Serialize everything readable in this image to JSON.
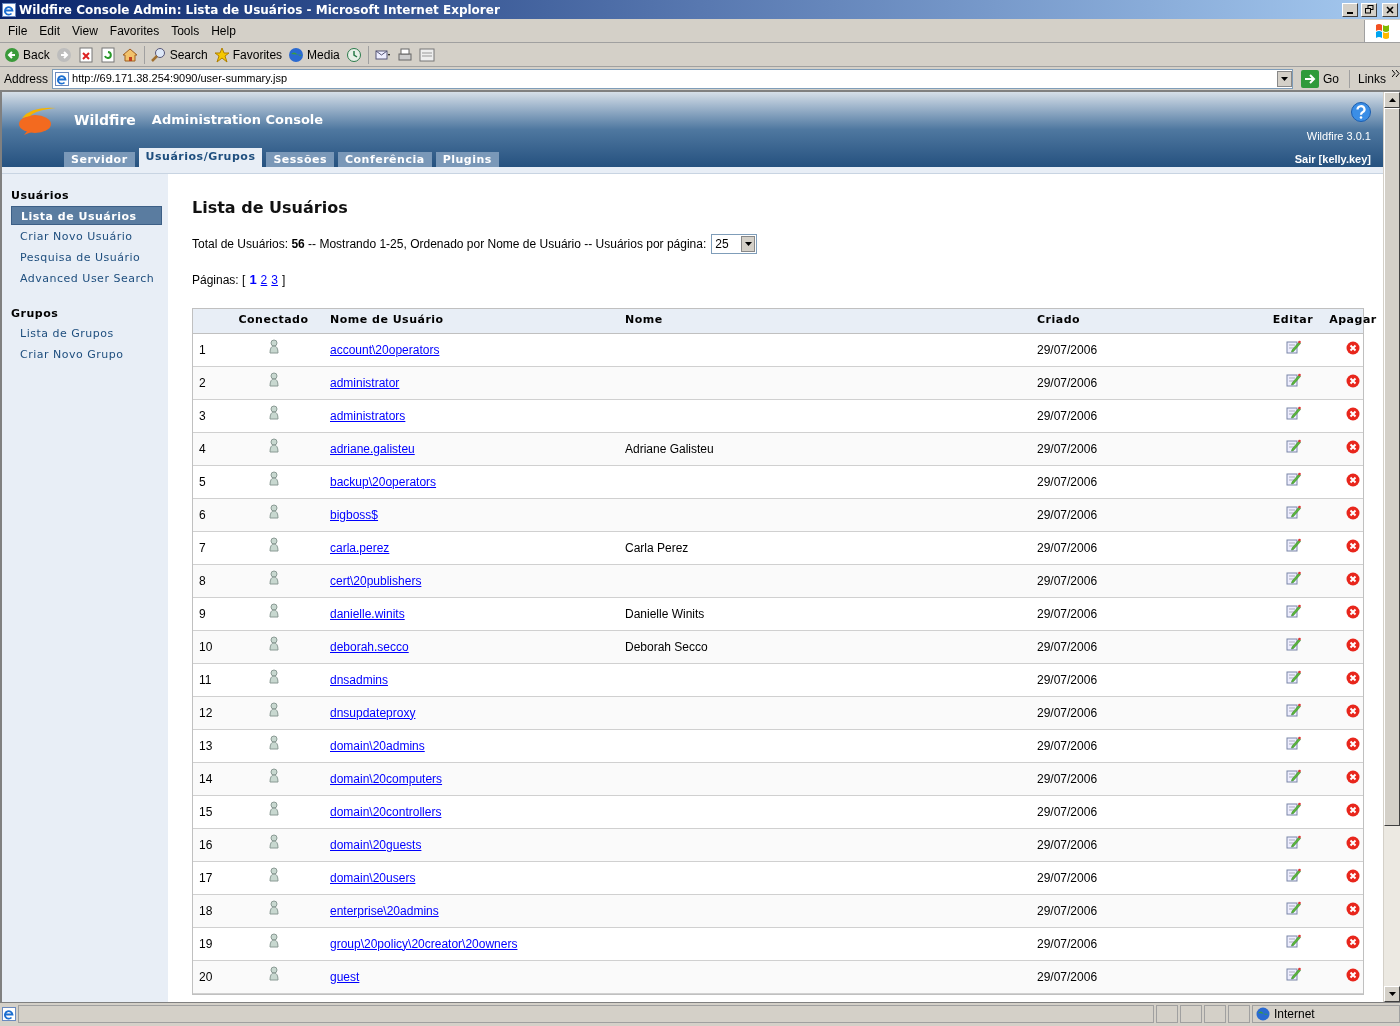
{
  "window": {
    "title": "Wildfire Console Admin: Lista de Usuários - Microsoft Internet Explorer"
  },
  "menu": [
    "File",
    "Edit",
    "View",
    "Favorites",
    "Tools",
    "Help"
  ],
  "toolbar": [
    {
      "kind": "back",
      "label": "Back"
    },
    {
      "kind": "forward"
    },
    {
      "kind": "stop"
    },
    {
      "kind": "refresh"
    },
    {
      "kind": "home"
    },
    {
      "kind": "search",
      "label": "Search"
    },
    {
      "kind": "favorites",
      "label": "Favorites"
    },
    {
      "kind": "media",
      "label": "Media"
    },
    {
      "kind": "history"
    },
    {
      "kind": "mail"
    },
    {
      "kind": "print"
    },
    {
      "kind": "edit"
    }
  ],
  "address": {
    "label": "Address",
    "url": "http://69.171.38.254:9090/user-summary.jsp",
    "go": "Go",
    "links": "Links"
  },
  "header": {
    "brand": "Wildfire",
    "title": "Administration Console",
    "version": "Wildfire 3.0.1",
    "logout": "Sair [kelly.key]"
  },
  "tabs": [
    {
      "label": "Servidor",
      "selected": false
    },
    {
      "label": "Usuários/Grupos",
      "selected": true
    },
    {
      "label": "Sessões",
      "selected": false
    },
    {
      "label": "Conferência",
      "selected": false
    },
    {
      "label": "Plugins",
      "selected": false
    }
  ],
  "sidebar": [
    {
      "heading": "Usuários",
      "items": [
        {
          "label": "Lista de Usuários",
          "selected": true
        },
        {
          "label": "Criar Novo Usuário",
          "selected": false
        },
        {
          "label": "Pesquisa de Usuário",
          "selected": false
        },
        {
          "label": "Advanced User Search",
          "selected": false
        }
      ]
    },
    {
      "heading": "Grupos",
      "items": [
        {
          "label": "Lista de Grupos",
          "selected": false
        },
        {
          "label": "Criar Novo Grupo",
          "selected": false
        }
      ]
    }
  ],
  "page": {
    "title": "Lista de Usuários",
    "summary": "Total de Usuários: **56** -- Mostrando 1-25, Ordenado por Nome de Usuário -- Usuários por página:",
    "per_page": "25",
    "pages_label": "Páginas: [",
    "pages": [
      {
        "label": "1",
        "selected": true
      },
      {
        "label": "2",
        "selected": false
      },
      {
        "label": "3",
        "selected": false
      }
    ],
    "pages_end": "]"
  },
  "table": {
    "columns": [
      null,
      "Conectado",
      "Nome de Usuário",
      "Nome",
      "Criado",
      "Editar",
      "Apagar"
    ],
    "rows": [
      {
        "index": "1",
        "username": "account\\20operators",
        "created": "29/07/2006"
      },
      {
        "index": "2",
        "username": "administrator",
        "created": "29/07/2006"
      },
      {
        "index": "3",
        "username": "administrators",
        "created": "29/07/2006"
      },
      {
        "index": "4",
        "username": "adriane.galisteu",
        "name": "Adriane Galisteu",
        "created": "29/07/2006"
      },
      {
        "index": "5",
        "username": "backup\\20operators",
        "created": "29/07/2006"
      },
      {
        "index": "6",
        "username": "bigboss$",
        "created": "29/07/2006"
      },
      {
        "index": "7",
        "username": "carla.perez",
        "name": "Carla Perez",
        "created": "29/07/2006"
      },
      {
        "index": "8",
        "username": "cert\\20publishers",
        "created": "29/07/2006"
      },
      {
        "index": "9",
        "username": "danielle.winits",
        "name": "Danielle Winits",
        "created": "29/07/2006"
      },
      {
        "index": "10",
        "username": "deborah.secco",
        "name": "Deborah Secco",
        "created": "29/07/2006"
      },
      {
        "index": "11",
        "username": "dnsadmins",
        "created": "29/07/2006"
      },
      {
        "index": "12",
        "username": "dnsupdateproxy",
        "created": "29/07/2006"
      },
      {
        "index": "13",
        "username": "domain\\20admins",
        "created": "29/07/2006"
      },
      {
        "index": "14",
        "username": "domain\\20computers",
        "created": "29/07/2006"
      },
      {
        "index": "15",
        "username": "domain\\20controllers",
        "created": "29/07/2006"
      },
      {
        "index": "16",
        "username": "domain\\20guests",
        "created": "29/07/2006"
      },
      {
        "index": "17",
        "username": "domain\\20users",
        "created": "29/07/2006"
      },
      {
        "index": "18",
        "username": "enterprise\\20admins",
        "created": "29/07/2006"
      },
      {
        "index": "19",
        "username": "group\\20policy\\20creator\\20owners",
        "created": "29/07/2006"
      },
      {
        "index": "20",
        "username": "guest",
        "created": "29/07/2006"
      }
    ]
  },
  "status_bar": {
    "zone": "Internet"
  }
}
